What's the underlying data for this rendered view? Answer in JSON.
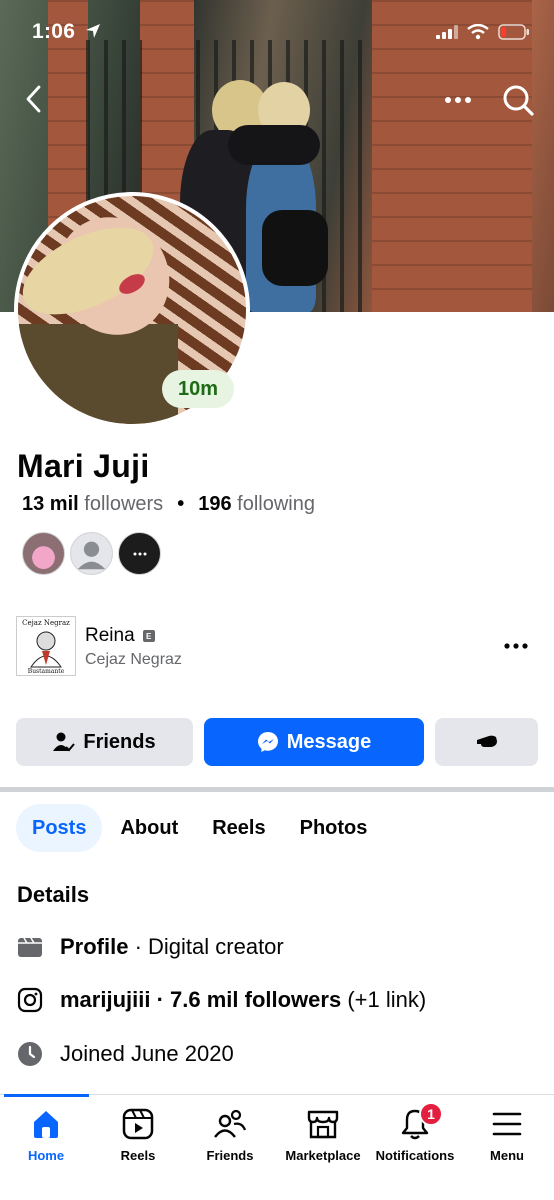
{
  "status_bar": {
    "time": "1:06"
  },
  "profile": {
    "name": "Mari Juji",
    "active_badge": "10m",
    "followers_count": "13 mil",
    "followers_label": "followers",
    "following_count": "196",
    "following_label": "following"
  },
  "work": {
    "role": "Reina",
    "role_badge": "E",
    "organization": "Cejaz Negraz",
    "logo_text_top": "Cejaz Negraz",
    "logo_text_bottom": "Bustamante"
  },
  "actions": {
    "friends_label": "Friends",
    "message_label": "Message"
  },
  "tabs": [
    {
      "label": "Posts",
      "active": true
    },
    {
      "label": "About",
      "active": false
    },
    {
      "label": "Reels",
      "active": false
    },
    {
      "label": "Photos",
      "active": false
    }
  ],
  "details": {
    "title": "Details",
    "category_bold": "Profile",
    "category_rest": " · Digital creator",
    "instagram_handle": "marijujiii",
    "instagram_followers": " · 7.6 mil followers",
    "instagram_links": " (+1 link)",
    "joined": "Joined June 2020"
  },
  "bottom_nav": {
    "home": "Home",
    "reels": "Reels",
    "friends": "Friends",
    "marketplace": "Marketplace",
    "notifications": "Notifications",
    "notifications_count": "1",
    "menu": "Menu"
  },
  "colors": {
    "accent": "#0866ff",
    "active_green": "#1f6a16",
    "badge_red": "#e41e3f"
  }
}
